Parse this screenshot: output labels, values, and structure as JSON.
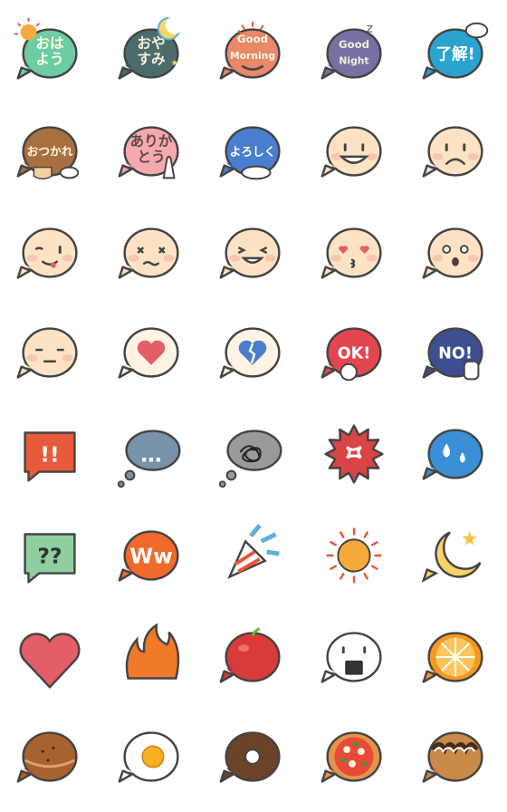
{
  "sheet": {
    "columns": 5,
    "items": [
      {
        "name": "ohayou",
        "text": [
          "おは",
          "よう"
        ],
        "color": "#6ccca4",
        "fg": "#fffbe0",
        "extra": "sun",
        "shape": "bubble"
      },
      {
        "name": "oyasumi",
        "text": [
          "おや",
          "すみ"
        ],
        "color": "#4b6c6a",
        "fg": "#f4f0dc",
        "extra": "moon",
        "shape": "bubble"
      },
      {
        "name": "good-morning",
        "text": [
          "Good",
          "Morning"
        ],
        "color": "#e8896a",
        "fg": "#fff4e0",
        "extra": "rays",
        "face": "smile-mouth",
        "shape": "bubble"
      },
      {
        "name": "good-night",
        "text": [
          "Good",
          "Night"
        ],
        "color": "#7a6fa3",
        "fg": "#f4f0dc",
        "extra": "zz",
        "shape": "bubble"
      },
      {
        "name": "ryoukai",
        "text": [
          "了解!"
        ],
        "color": "#2aa3d0",
        "fg": "#ffffff",
        "extra": "salute-hand",
        "shape": "bubble"
      },
      {
        "name": "otsukare",
        "text": [
          "おつかれ"
        ],
        "color": "#a8703f",
        "fg": "#fff4e0",
        "extra": "coffee",
        "shape": "bubble"
      },
      {
        "name": "arigatou",
        "text": [
          "ありが",
          "とう"
        ],
        "color": "#f6a9ad",
        "fg": "#5a4a4a",
        "extra": "hands",
        "shape": "bubble"
      },
      {
        "name": "yoroshiku",
        "text": [
          "よろしく"
        ],
        "color": "#4a7fcf",
        "fg": "#ffffff",
        "extra": "handshake",
        "shape": "bubble"
      },
      {
        "name": "smile-face",
        "color": "#fde3c4",
        "face": "smile",
        "shape": "bubble"
      },
      {
        "name": "sad-face",
        "color": "#fde3c4",
        "face": "frown",
        "shape": "bubble"
      },
      {
        "name": "tongue-face",
        "color": "#fde3c4",
        "face": "tongue",
        "shape": "bubble"
      },
      {
        "name": "dizzy-face",
        "color": "#fde3c4",
        "face": "x-eyes",
        "shape": "bubble"
      },
      {
        "name": "grin-face",
        "color": "#fde3c4",
        "face": "grin",
        "shape": "bubble"
      },
      {
        "name": "heart-eyes-face",
        "color": "#fde3c4",
        "face": "heart-eyes",
        "shape": "bubble"
      },
      {
        "name": "surprised-face",
        "color": "#fde3c4",
        "face": "surprised",
        "shape": "bubble"
      },
      {
        "name": "neutral-face",
        "color": "#fde3c4",
        "face": "neutral",
        "shape": "bubble"
      },
      {
        "name": "heart-bubble",
        "color": "#fff3e4",
        "glyph": "heart",
        "glyphColor": "#e35e66",
        "shape": "bubble"
      },
      {
        "name": "broken-heart-bubble",
        "color": "#fff3e4",
        "glyph": "broken-heart",
        "glyphColor": "#4a7fcf",
        "shape": "bubble"
      },
      {
        "name": "ok",
        "text": [
          "OK!"
        ],
        "color": "#e2474f",
        "fg": "#ffffff",
        "extra": "ok-hand",
        "shape": "bubble"
      },
      {
        "name": "no",
        "text": [
          "NO!"
        ],
        "color": "#3d4f8e",
        "fg": "#ffffff",
        "extra": "stop-hand",
        "shape": "bubble"
      },
      {
        "name": "exclaim",
        "text": [
          "!!"
        ],
        "color": "#e85a3c",
        "fg": "#ffffff",
        "shape": "square"
      },
      {
        "name": "ellipsis",
        "text": [
          "…"
        ],
        "color": "#7892a8",
        "fg": "#ffffff",
        "shape": "thought"
      },
      {
        "name": "scribble",
        "color": "#9a9a9a",
        "glyph": "scribble",
        "shape": "thought"
      },
      {
        "name": "anger",
        "color": "#d94444",
        "glyph": "anger",
        "shape": "burst"
      },
      {
        "name": "sweat",
        "color": "#3a8fd6",
        "glyph": "drops",
        "shape": "bubble"
      },
      {
        "name": "question",
        "text": [
          "??"
        ],
        "color": "#8fcf9f",
        "fg": "#333333",
        "shape": "square"
      },
      {
        "name": "ww",
        "text": [
          "Ww"
        ],
        "color": "#f06a2a",
        "fg": "#ffffff",
        "shape": "bubble"
      },
      {
        "name": "party-popper",
        "glyph": "party",
        "shape": "none"
      },
      {
        "name": "sun",
        "color": "#f7a93b",
        "glyph": "sun",
        "shape": "none"
      },
      {
        "name": "moon",
        "color": "#f7d36a",
        "glyph": "moon",
        "shape": "bubble-moon"
      },
      {
        "name": "heart",
        "color": "#e35e66",
        "shape": "heart"
      },
      {
        "name": "fire",
        "color": "#f07a2a",
        "glyph": "fire",
        "shape": "none"
      },
      {
        "name": "apple",
        "color": "#d93a3a",
        "glyph": "apple",
        "shape": "bubble"
      },
      {
        "name": "onigiri",
        "color": "#ffffff",
        "glyph": "onigiri",
        "shape": "bubble"
      },
      {
        "name": "orange-slice",
        "color": "#f59a1e",
        "glyph": "orange",
        "shape": "bubble"
      },
      {
        "name": "bread",
        "color": "#a8622f",
        "glyph": "bread",
        "shape": "bubble"
      },
      {
        "name": "fried-egg",
        "color": "#ffffff",
        "glyph": "egg",
        "shape": "bubble"
      },
      {
        "name": "donut",
        "color": "#6b4328",
        "glyph": "donut",
        "shape": "bubble"
      },
      {
        "name": "pizza",
        "color": "#e0954a",
        "glyph": "pizza",
        "shape": "bubble"
      },
      {
        "name": "takoyaki",
        "color": "#c98a4a",
        "glyph": "takoyaki",
        "shape": "bubble"
      }
    ]
  }
}
